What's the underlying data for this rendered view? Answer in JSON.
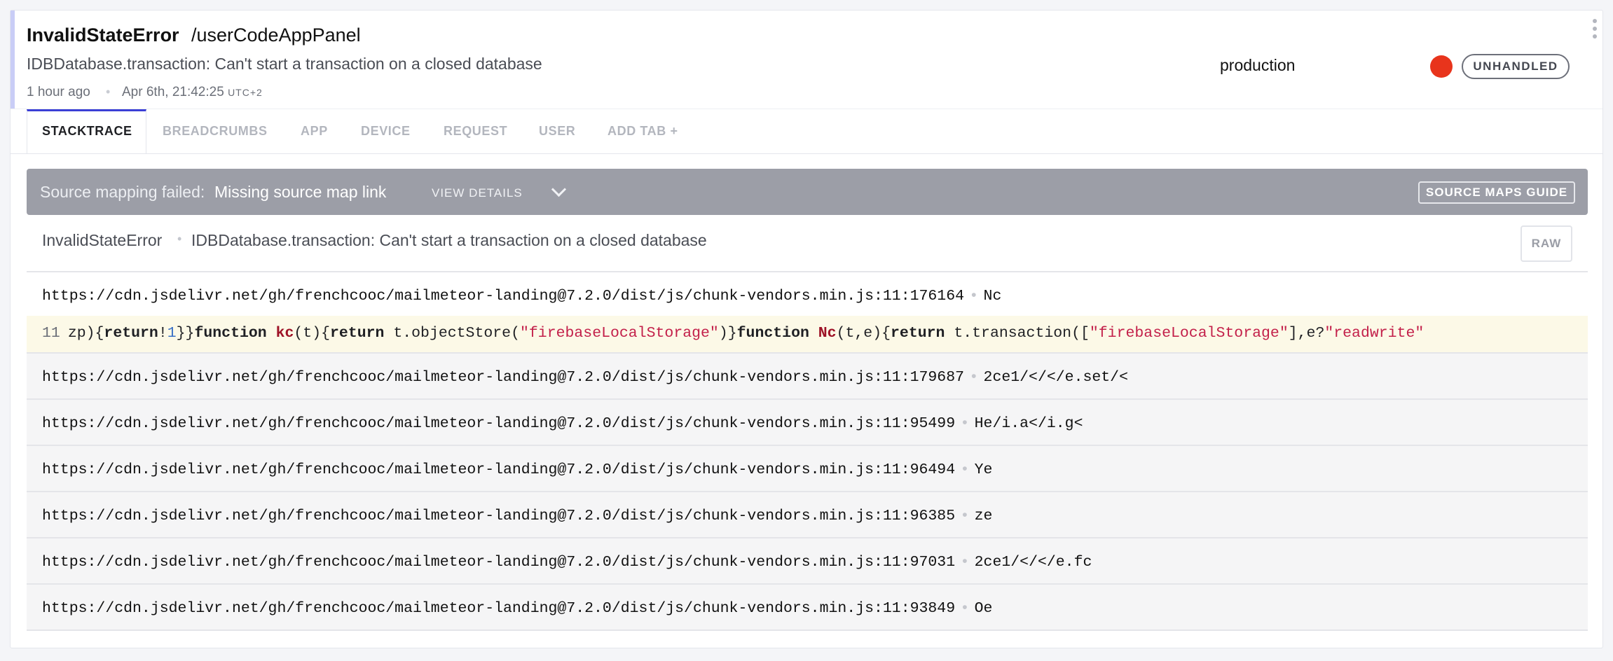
{
  "header": {
    "error_class": "InvalidStateError",
    "context": "/userCodeAppPanel",
    "message": "IDBDatabase.transaction: Can't start a transaction on a closed database",
    "time_relative": "1 hour ago",
    "time_absolute": "Apr 6th, 21:42:25",
    "timezone": "UTC+2",
    "environment": "production",
    "severity_color": "#e8341c",
    "handled_badge": "UNHANDLED"
  },
  "tabs": [
    {
      "label": "STACKTRACE",
      "active": true
    },
    {
      "label": "BREADCRUMBS"
    },
    {
      "label": "APP"
    },
    {
      "label": "DEVICE"
    },
    {
      "label": "REQUEST"
    },
    {
      "label": "USER"
    },
    {
      "label": "ADD TAB",
      "icon": "plus-icon"
    }
  ],
  "banner": {
    "label": "Source mapping failed:",
    "reason": "Missing source map link",
    "view_details": "VIEW DETAILS",
    "guide_button": "SOURCE MAPS GUIDE"
  },
  "exception": {
    "class": "InvalidStateError",
    "message": "IDBDatabase.transaction: Can't start a transaction on a closed database",
    "raw_button": "RAW"
  },
  "code_line": {
    "line_number": "11",
    "tokens": [
      {
        "t": "zp){"
      },
      {
        "t": "return",
        "k": "kw"
      },
      {
        "t": "!"
      },
      {
        "t": "1",
        "k": "num"
      },
      {
        "t": "}}"
      },
      {
        "t": "function",
        "k": "kw"
      },
      {
        "t": " "
      },
      {
        "t": "kc",
        "k": "fn"
      },
      {
        "t": "(t){"
      },
      {
        "t": "return",
        "k": "kw"
      },
      {
        "t": " t.objectStore("
      },
      {
        "t": "\"firebaseLocalStorage\"",
        "k": "str"
      },
      {
        "t": ")}"
      },
      {
        "t": "function",
        "k": "kw"
      },
      {
        "t": " "
      },
      {
        "t": "Nc",
        "k": "fn"
      },
      {
        "t": "(t,e){"
      },
      {
        "t": "return",
        "k": "kw"
      },
      {
        "t": " t.transaction(["
      },
      {
        "t": "\"firebaseLocalStorage\"",
        "k": "str"
      },
      {
        "t": "],e?"
      },
      {
        "t": "\"readwrite\"",
        "k": "str"
      }
    ]
  },
  "frames": [
    {
      "file": "https://cdn.jsdelivr.net/gh/frenchcooc/mailmeteor-landing@7.2.0/dist/js/chunk-vendors.min.js:11:176164",
      "method": "Nc"
    },
    {
      "file": "https://cdn.jsdelivr.net/gh/frenchcooc/mailmeteor-landing@7.2.0/dist/js/chunk-vendors.min.js:11:179687",
      "method": "2ce1/</</e.set/<"
    },
    {
      "file": "https://cdn.jsdelivr.net/gh/frenchcooc/mailmeteor-landing@7.2.0/dist/js/chunk-vendors.min.js:11:95499",
      "method": "He/i.a</i.g<"
    },
    {
      "file": "https://cdn.jsdelivr.net/gh/frenchcooc/mailmeteor-landing@7.2.0/dist/js/chunk-vendors.min.js:11:96494",
      "method": "Ye"
    },
    {
      "file": "https://cdn.jsdelivr.net/gh/frenchcooc/mailmeteor-landing@7.2.0/dist/js/chunk-vendors.min.js:11:96385",
      "method": "ze"
    },
    {
      "file": "https://cdn.jsdelivr.net/gh/frenchcooc/mailmeteor-landing@7.2.0/dist/js/chunk-vendors.min.js:11:97031",
      "method": "2ce1/</</e.fc"
    },
    {
      "file": "https://cdn.jsdelivr.net/gh/frenchcooc/mailmeteor-landing@7.2.0/dist/js/chunk-vendors.min.js:11:93849",
      "method": "Oe"
    }
  ]
}
